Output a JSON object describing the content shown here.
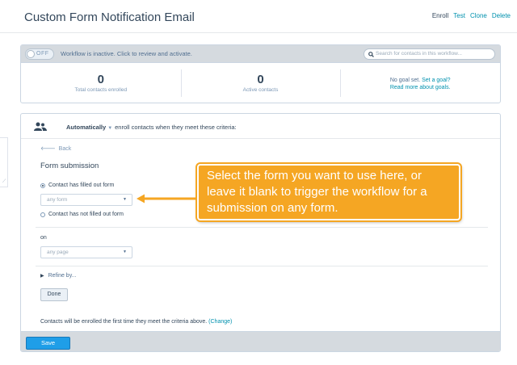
{
  "header": {
    "title": "Custom Form Notification Email",
    "actions": [
      "Enroll",
      "Test",
      "Clone",
      "Delete"
    ]
  },
  "status_bar": {
    "toggle_label": "OFF",
    "message": "Workflow is inactive. Click to review and activate.",
    "search_placeholder": "Search for contacts in this workflow..."
  },
  "stats": {
    "total_enrolled": "0",
    "total_enrolled_label": "Total contacts enrolled",
    "active": "0",
    "active_label": "Active contacts",
    "goal_text": "No goal set.",
    "goal_link": "Set a goal?",
    "goal_more": "Read more about goals."
  },
  "trigger": {
    "mode": "Automatically",
    "description": "enroll contacts when they meet these criteria:",
    "back_label": "Back",
    "section_title": "Form submission",
    "option_filled": "Contact has filled out form",
    "form_select_value": "any form",
    "option_not_filled": "Contact has not filled out form",
    "on_label": "on",
    "page_select_value": "any page",
    "refine_label": "Refine by...",
    "done_label": "Done",
    "note": "Contacts will be enrolled the first time they meet the criteria above.",
    "note_link": "(Change)"
  },
  "footer": {
    "save_label": "Save"
  },
  "callout": {
    "text": "Select the form you want to use here, or leave it blank to trigger the workflow for a submission on any form.",
    "color": "#f5a623"
  },
  "colors": {
    "link": "#0091ae",
    "save": "#1f9ee8",
    "text": "#33475b"
  }
}
